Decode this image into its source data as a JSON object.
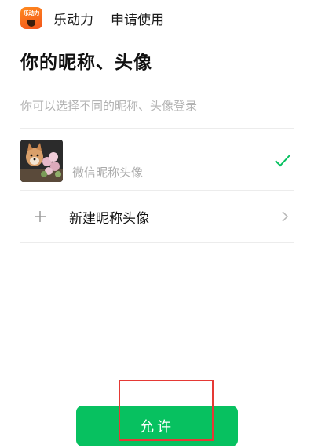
{
  "header": {
    "logo_text": "乐动力",
    "app_name": "乐动力",
    "action": "申请使用"
  },
  "title": "你的昵称、头像",
  "hint": "你可以选择不同的昵称、头像登录",
  "options": {
    "wechat_label": "微信昵称头像",
    "new_label": "新建昵称头像"
  },
  "icons": {
    "check": "check-icon",
    "plus": "plus-icon",
    "chevron": "chevron-right-icon"
  },
  "colors": {
    "accent": "#07c160",
    "highlight": "#e53935",
    "logo": "#f2541b"
  },
  "allow_button": "允许"
}
